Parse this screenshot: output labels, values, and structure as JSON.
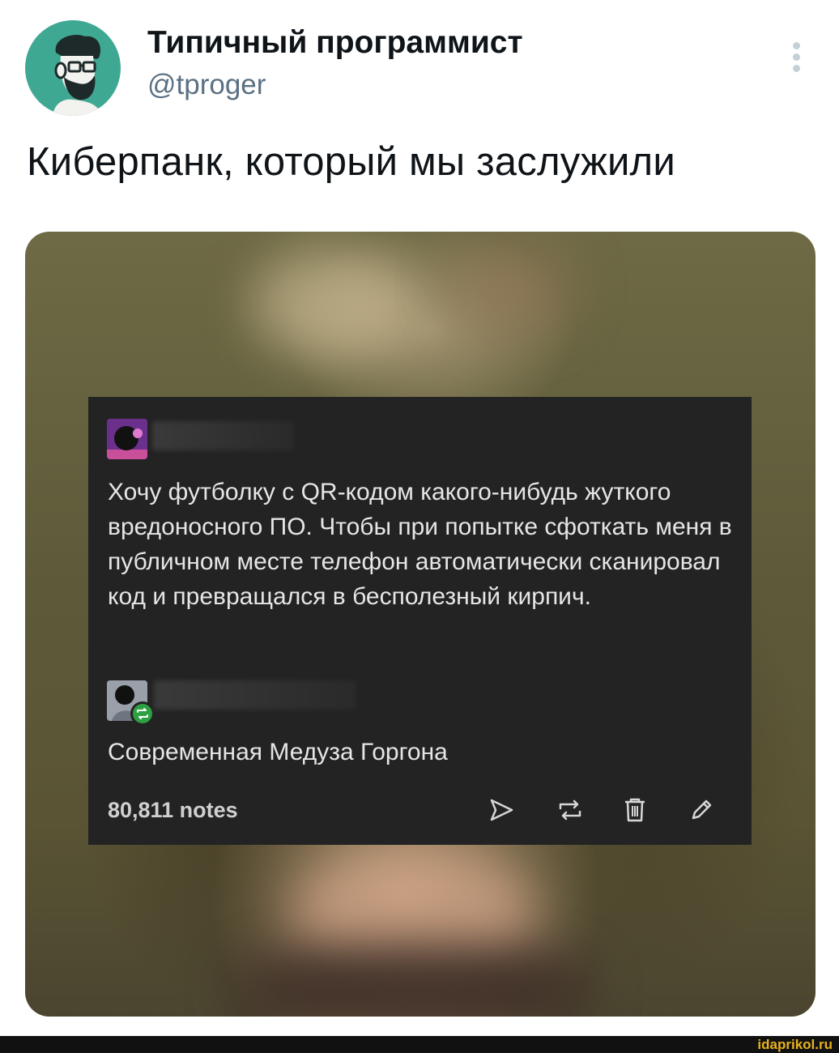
{
  "tweet": {
    "author_name": "Типичный программист",
    "author_handle": "@tproger",
    "text": "Киберпанк, который мы заслужили",
    "menu_icon": "more-vertical-icon"
  },
  "tumblr_post": {
    "text": "Хочу футболку с QR-кодом какого-нибудь жуткого вредоносного ПО. Чтобы при попытке сфоткать меня в публичном месте телефон автоматически сканировал код и превращался в бесполезный кирпич.",
    "reblog_comment": "Современная Медуза Горгона",
    "notes": "80,811 notes",
    "actions": [
      "share-icon",
      "reblog-icon",
      "delete-icon",
      "edit-icon"
    ],
    "reblog_badge_color": "#2ea043"
  },
  "watermark": "idaprikol.ru",
  "colors": {
    "avatar_bg": "#3fa893",
    "card_bg": "#232323",
    "handle": "#5b7083",
    "watermark": "#e8b21f"
  }
}
